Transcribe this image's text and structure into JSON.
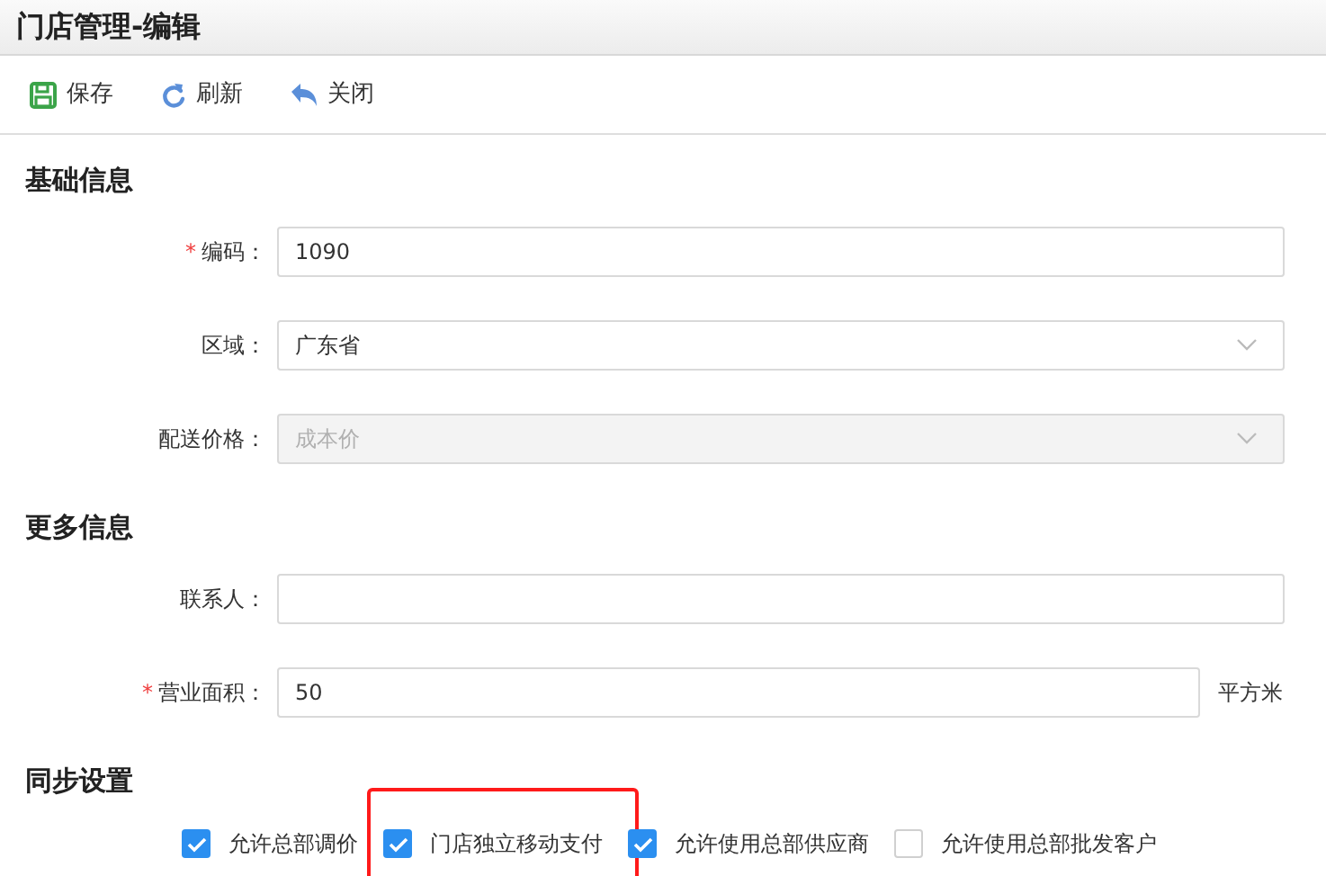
{
  "window": {
    "title": "门店管理-编辑"
  },
  "toolbar": [
    {
      "kind": "save",
      "label": "保存"
    },
    {
      "kind": "refresh",
      "label": "刷新"
    },
    {
      "kind": "close",
      "label": "关闭"
    }
  ],
  "sections": [
    {
      "title": "基础信息",
      "fields": [
        {
          "kind": "text",
          "label": "编码：",
          "required_mark": "*",
          "value": "1090",
          "disabled": false
        },
        {
          "kind": "select",
          "label": "区域：",
          "value": "广东省",
          "disabled": false
        },
        {
          "kind": "select",
          "label": "配送价格：",
          "value": "成本价",
          "disabled": true
        }
      ]
    },
    {
      "title": "更多信息",
      "fields": [
        {
          "kind": "text",
          "label": "联系人：",
          "disabled": false
        },
        {
          "kind": "text",
          "label": "营业面积：",
          "required_mark": "*",
          "value": "50",
          "disabled": false,
          "unit": "平方米"
        }
      ]
    },
    {
      "title": "同步设置",
      "checkboxes": [
        {
          "label": "允许总部调价",
          "checked": true,
          "highlighted": false
        },
        {
          "label": "门店独立移动支付",
          "checked": true,
          "highlighted": true
        },
        {
          "label": "允许使用总部供应商",
          "checked": true,
          "highlighted": false
        },
        {
          "label": "允许使用总部批发客户",
          "checked": false,
          "highlighted": false
        }
      ]
    }
  ]
}
